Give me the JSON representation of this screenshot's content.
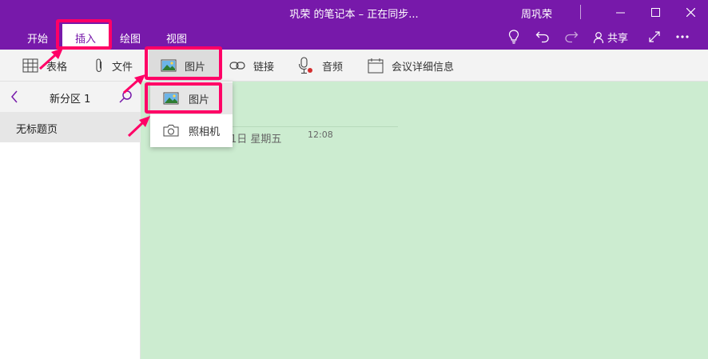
{
  "window": {
    "title": "巩荣 的笔记本 – 正在同步...",
    "user": "周巩荣",
    "buttons": [
      "minimize",
      "maximize",
      "close"
    ]
  },
  "ribbon": {
    "tabs": [
      {
        "label": "开始",
        "active": false
      },
      {
        "label": "插入",
        "active": true
      },
      {
        "label": "绘图",
        "active": false
      },
      {
        "label": "视图",
        "active": false
      }
    ],
    "share_label": "共享",
    "icons": [
      "lightbulb-icon",
      "undo-icon",
      "redo-icon",
      "person-icon",
      "expand-icon",
      "more-icon"
    ]
  },
  "toolbar": {
    "items": [
      {
        "label": "表格",
        "icon": "table-icon"
      },
      {
        "label": "文件",
        "icon": "paperclip-icon"
      },
      {
        "label": "图片",
        "icon": "picture-icon"
      },
      {
        "label": "链接",
        "icon": "link-icon"
      },
      {
        "label": "音频",
        "icon": "microphone-icon"
      },
      {
        "label": "会议详细信息",
        "icon": "calendar-icon"
      }
    ]
  },
  "dropdown": {
    "items": [
      {
        "label": "图片",
        "icon": "picture-icon"
      },
      {
        "label": "照相机",
        "icon": "camera-icon"
      }
    ]
  },
  "section": {
    "name": "新分区 1",
    "pages": [
      {
        "title": "无标题页"
      }
    ]
  },
  "page": {
    "date": "1日 星期五",
    "time": "12:08"
  },
  "colors": {
    "accent": "#7719aa",
    "canvas": "#ccecd0",
    "highlight": "#ff0066"
  }
}
